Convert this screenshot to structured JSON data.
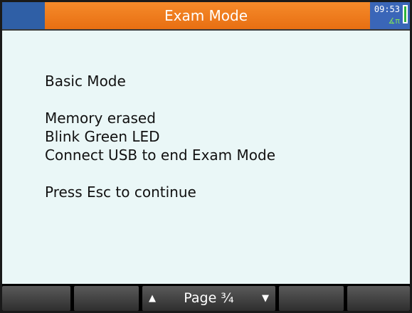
{
  "titlebar": {
    "title": "Exam Mode",
    "clock": "09:53",
    "angle_mode": "∡π"
  },
  "message": {
    "line1": "Basic Mode",
    "line2": "Memory erased",
    "line3": "Blink Green LED",
    "line4": "Connect USB to end Exam Mode",
    "line5": "Press Esc to continue"
  },
  "menu": {
    "page_label": "Page ¾",
    "up_arrow": "▲",
    "down_arrow": "▼"
  },
  "colors": {
    "title_bar": "#e86f12",
    "status_area": "#3a66b8",
    "background": "#eaf7f7",
    "battery": "#2db33c"
  }
}
